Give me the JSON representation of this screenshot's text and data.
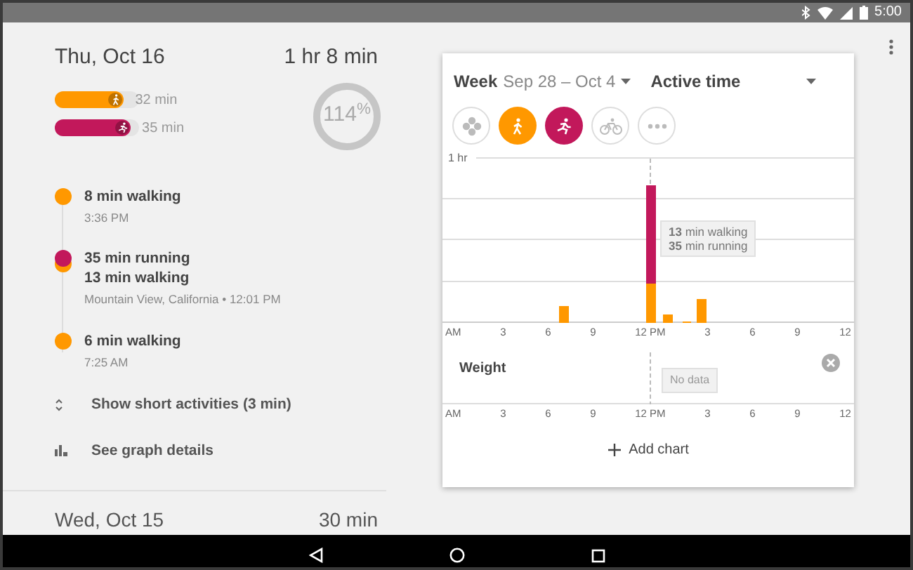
{
  "status_bar": {
    "time": "5:00"
  },
  "day": {
    "date": "Thu, Oct 16",
    "total": "1 hr 8 min",
    "goal_percent": "114$^{%}$",
    "summary": [
      {
        "kind": "walking",
        "label": "32 min",
        "level": 0.82,
        "color": "#ff9800"
      },
      {
        "kind": "running",
        "label": "35 min",
        "level": 0.9,
        "color": "#c2185b"
      }
    ],
    "timeline": [
      {
        "lines": [
          {
            "text": "8 min walking",
            "color": "#ff9800"
          }
        ],
        "detail": "3:36 PM"
      },
      {
        "lines": [
          {
            "text": "35 min running",
            "color": "#c2185b"
          },
          {
            "text": "13 min walking",
            "color": "#ff9800"
          }
        ],
        "detail": "Mountain View, California • 12:01 PM"
      },
      {
        "lines": [
          {
            "text": "6 min walking",
            "color": "#ff9800"
          }
        ],
        "detail": "7:25 AM"
      }
    ],
    "show_short": "Show short activities (3 min)",
    "graph_details": "See graph details"
  },
  "next_day": {
    "date": "Wed, Oct 15",
    "total": "30 min"
  },
  "card": {
    "period": "Week",
    "range": "Sep 28 – Oct 4",
    "metric": "Active time",
    "filters": [
      {
        "kind": "all",
        "selected": false
      },
      {
        "kind": "walking",
        "selected": true,
        "color": "#ff9800"
      },
      {
        "kind": "running",
        "selected": true,
        "color": "#c2185b"
      },
      {
        "kind": "biking",
        "selected": false
      },
      {
        "kind": "more",
        "selected": false
      }
    ],
    "y_label": "1 hr",
    "tooltip": [
      "**13** min walking",
      "**35** min running"
    ],
    "x_labels": [
      "AM",
      "3",
      "6",
      "9",
      "12 PM",
      "3",
      "6",
      "9",
      "12"
    ],
    "weight": {
      "title": "Weight",
      "tooltip": "No data",
      "x_labels": [
        "AM",
        "3",
        "6",
        "9",
        "12 PM",
        "3",
        "6",
        "9",
        "12"
      ]
    },
    "add_chart": "Add chart"
  }
}
